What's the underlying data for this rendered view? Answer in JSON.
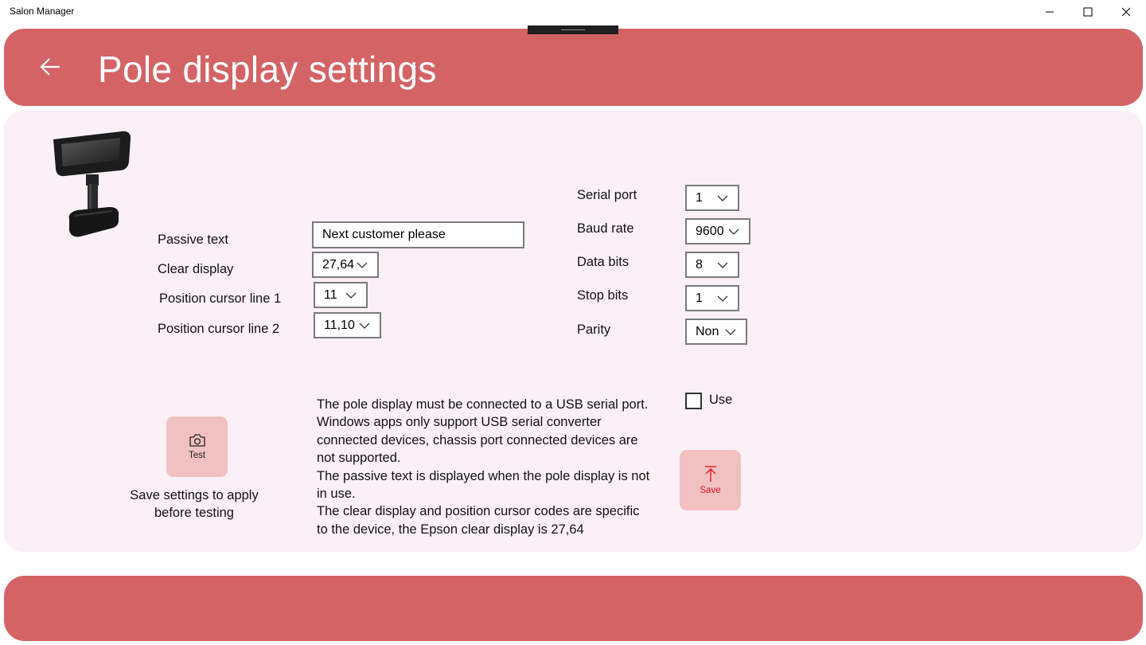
{
  "window": {
    "title": "Salon Manager"
  },
  "header": {
    "title": "Pole display settings",
    "back_icon": "arrow-left-icon"
  },
  "colors": {
    "accent": "#d46366",
    "panel_bg": "#fcf0f7",
    "button_bg": "#f1c1c1",
    "save_accent": "#e8141c"
  },
  "form": {
    "passive_text": {
      "label": "Passive text",
      "value": "Next customer please"
    },
    "clear_display": {
      "label": "Clear display",
      "value": "27,64"
    },
    "cursor_line1": {
      "label": "Position cursor line 1",
      "value": "11"
    },
    "cursor_line2": {
      "label": "Position cursor line 2",
      "value": "11,10"
    }
  },
  "serial": {
    "port": {
      "label": "Serial port",
      "value": "1"
    },
    "baud": {
      "label": "Baud rate",
      "value": "9600"
    },
    "data_bits": {
      "label": "Data bits",
      "value": "8"
    },
    "stop_bits": {
      "label": "Stop bits",
      "value": "1"
    },
    "parity": {
      "label": "Parity",
      "value": "Non"
    }
  },
  "use": {
    "label": "Use",
    "checked": false
  },
  "buttons": {
    "test": {
      "label": "Test",
      "icon": "camera-icon"
    },
    "save": {
      "label": "Save",
      "icon": "upload-arrow-icon"
    }
  },
  "hint": {
    "line1": "Save settings to apply",
    "line2": "before testing"
  },
  "info": {
    "p1": "The pole display must be connected to a USB serial port.",
    "p2": "Windows apps only support USB serial converter connected devices, chassis port connected devices are not supported.",
    "p3": "The passive text is displayed when the pole display is not in use.",
    "p4": "The clear display and position cursor codes are specific to the device, the Epson clear display is 27,64"
  }
}
